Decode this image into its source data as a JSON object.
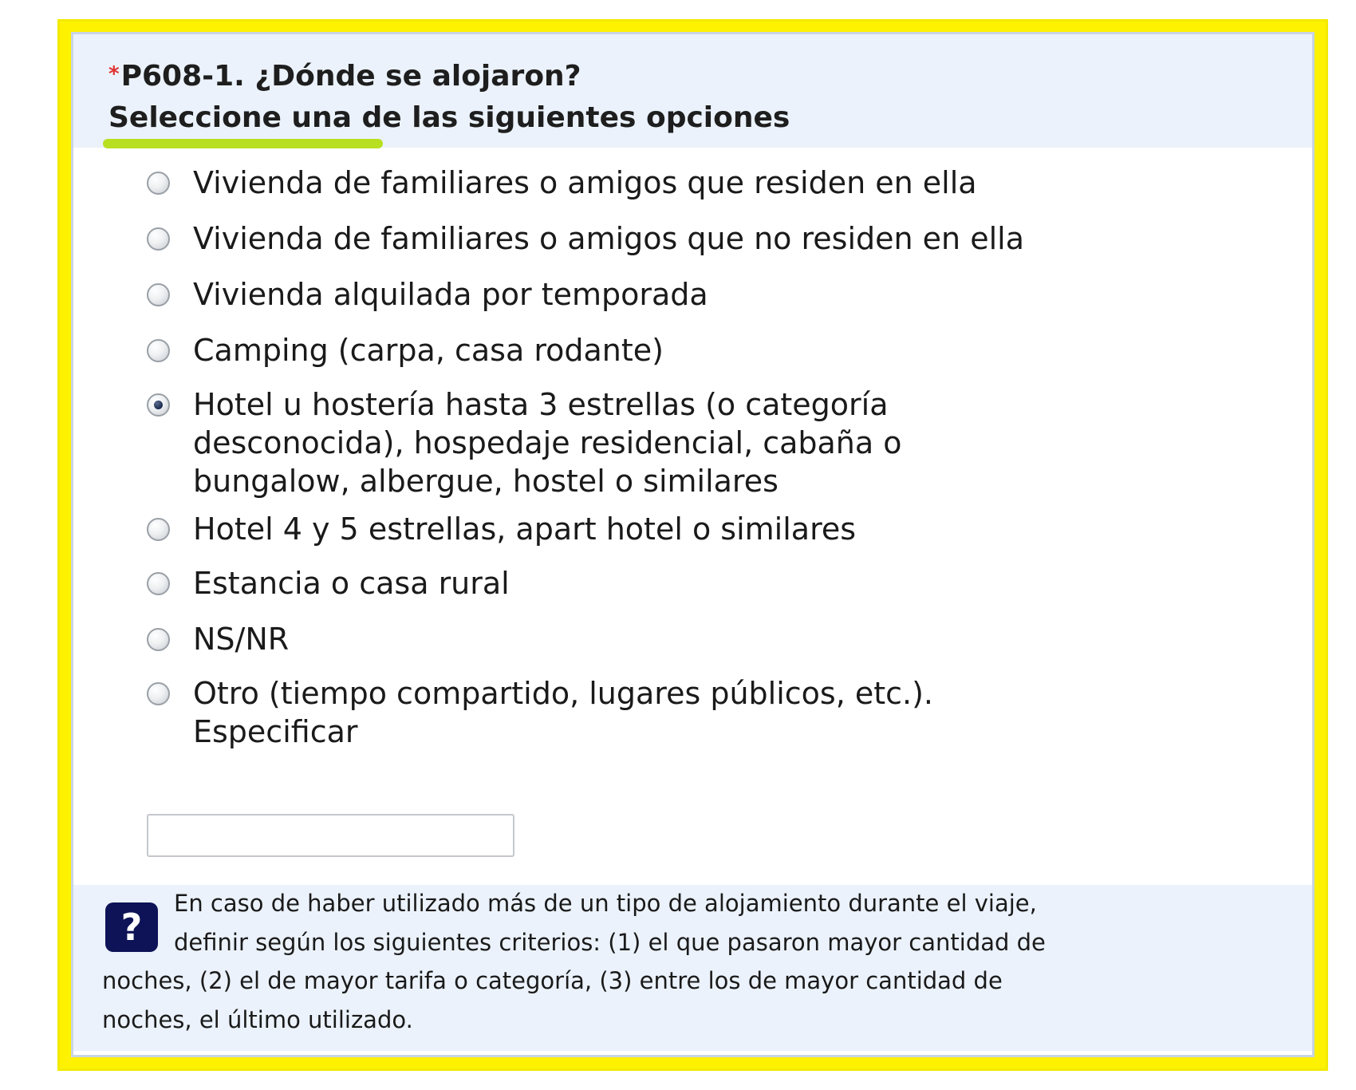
{
  "question": {
    "required_mark": "*",
    "title": "P608-1. ¿Dónde se alojaron?",
    "instruction": "Seleccione una de las siguientes opciones"
  },
  "options": [
    {
      "label_lines": [
        "Vivienda de familiares o amigos que residen en ella"
      ],
      "checked": false
    },
    {
      "label_lines": [
        "Vivienda de familiares o amigos que no residen en ella"
      ],
      "checked": false
    },
    {
      "label_lines": [
        "Vivienda alquilada por temporada"
      ],
      "checked": false
    },
    {
      "label_lines": [
        "Camping (carpa, casa rodante)"
      ],
      "checked": false
    },
    {
      "label_lines": [
        "Hotel u hostería hasta 3 estrellas (o categoría",
        "desconocida), hospedaje residencial, cabaña o",
        "bungalow, albergue, hostel o similares"
      ],
      "checked": true
    },
    {
      "label_lines": [
        "Hotel 4 y 5 estrellas, apart hotel o similares"
      ],
      "checked": false
    },
    {
      "label_lines": [
        "Estancia o casa rural"
      ],
      "checked": false
    },
    {
      "label_lines": [
        "NS/NR"
      ],
      "checked": false
    },
    {
      "label_lines": [
        "Otro (tiempo compartido, lugares públicos, etc.).",
        "Especificar"
      ],
      "checked": false
    }
  ],
  "other_input": {
    "value": "",
    "placeholder": ""
  },
  "help": {
    "icon": "question-mark-icon",
    "icon_glyph": "?",
    "lines": [
      "En caso de haber utilizado más de un tipo de alojamiento durante el viaje,",
      "definir según los siguientes criterios: (1) el que pasaron mayor cantidad de",
      "noches, (2) el de mayor tarifa o categoría, (3) entre los de mayor cantidad de",
      "noches, el último utilizado."
    ]
  },
  "colors": {
    "frame_highlight": "#fff200",
    "panel_bg": "#ebf2fb",
    "underline_highlight": "#b8e021",
    "required": "#e03131",
    "help_icon_bg": "#0d1356"
  }
}
